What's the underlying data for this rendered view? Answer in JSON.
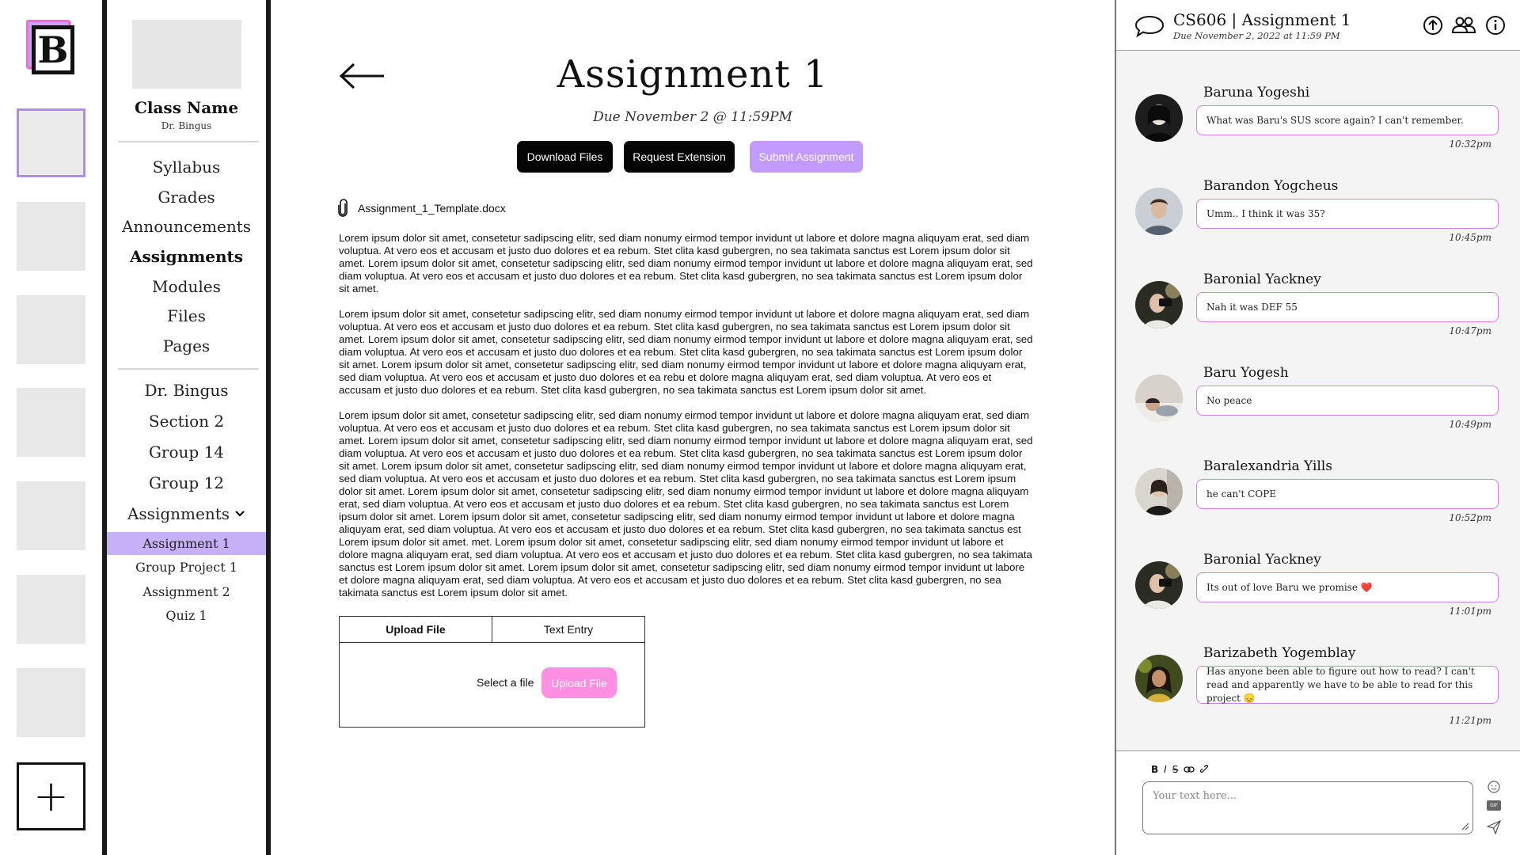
{
  "rail": {
    "logo_letter": "B",
    "add_symbol": "+"
  },
  "course": {
    "name": "Class Name",
    "professor": "Dr. Bingus",
    "menu": [
      "Syllabus",
      "Grades",
      "Announcements",
      "Assignments",
      "Modules",
      "Files",
      "Pages"
    ],
    "active_menu": "Assignments",
    "groups": [
      "Dr. Bingus",
      "Section 2",
      "Group 14",
      "Group 12"
    ],
    "assignments_toggle": "Assignments",
    "assignments": [
      "Assignment 1",
      "Group Project 1",
      "Assignment 2",
      "Quiz 1"
    ],
    "active_assignment": "Assignment 1"
  },
  "main": {
    "title": "Assignment 1",
    "due": "Due November 2 @ 11:59PM",
    "buttons": {
      "download": "Download Files",
      "extension": "Request Extension",
      "submit": "Submit Assignment"
    },
    "attachment": "Assignment_1_Template.docx",
    "paragraphs": [
      "Lorem ipsum dolor sit amet, consetetur sadipscing elitr, sed diam nonumy eirmod tempor invidunt ut labore et dolore magna aliquyam erat, sed diam voluptua. At vero eos et accusam et justo duo dolores et ea rebum. Stet clita kasd gubergren, no sea takimata sanctus est Lorem ipsum dolor sit amet. Lorem ipsum dolor sit amet, consetetur sadipscing elitr, sed diam nonumy eirmod tempor invidunt ut labore et dolore magna aliquyam erat, sed diam voluptua. At vero eos et accusam et justo duo dolores et ea rebum. Stet clita kasd gubergren, no sea takimata sanctus est Lorem ipsum dolor sit amet.",
      "Lorem ipsum dolor sit amet, consetetur sadipscing elitr, sed diam nonumy eirmod tempor invidunt ut labore et dolore magna aliquyam erat, sed diam voluptua. At vero eos et accusam et justo duo dolores et ea rebum. Stet clita kasd gubergren, no sea takimata sanctus est Lorem ipsum dolor sit amet. Lorem ipsum dolor sit amet, consetetur sadipscing elitr, sed diam nonumy eirmod tempor invidunt ut labore et dolore magna aliquyam erat, sed diam voluptua. At vero eos et accusam et justo duo dolores et ea rebum. Stet clita kasd gubergren, no sea takimata sanctus est Lorem ipsum dolor sit amet. Lorem ipsum dolor sit amet, consetetur sadipscing elitr, sed diam nonumy eirmod tempor invidunt ut labore et dolore magna aliquyam erat, sed diam voluptua. At vero eos et accusam et justo duo dolores et ea rebu et dolore magna aliquyam erat, sed diam voluptua. At vero eos et accusam et justo duo dolores et ea rebum. Stet clita kasd gubergren, no sea takimata sanctus est Lorem ipsum dolor sit amet.",
      "Lorem ipsum dolor sit amet, consetetur sadipscing elitr, sed diam nonumy eirmod tempor invidunt ut labore et dolore magna aliquyam erat, sed diam voluptua. At vero eos et accusam et justo duo dolores et ea rebum. Stet clita kasd gubergren, no sea takimata sanctus est Lorem ipsum dolor sit amet. Lorem ipsum dolor sit amet, consetetur sadipscing elitr, sed diam nonumy eirmod tempor invidunt ut labore et dolore magna aliquyam erat, sed diam voluptua. At vero eos et accusam et justo duo dolores et ea rebum. Stet clita kasd gubergren, no sea takimata sanctus est Lorem ipsum dolor sit amet. Lorem ipsum dolor sit amet, consetetur sadipscing elitr, sed diam nonumy eirmod tempor invidunt ut labore et dolore magna aliquyam erat, sed diam voluptua. At vero eos et accusam et justo duo dolores et ea rebum. Stet clita kasd gubergren, no sea takimata sanctus est Lorem ipsum dolor sit amet. Lorem ipsum dolor sit amet, consetetur sadipscing elitr, sed diam nonumy eirmod tempor invidunt ut labore et dolore magna aliquyam erat, sed diam voluptua. At vero eos et accusam et justo duo dolores et ea rebum. Stet clita kasd gubergren, no sea takimata sanctus est Lorem ipsum dolor sit amet. Lorem ipsum dolor sit amet, consetetur sadipscing elitr, sed diam nonumy eirmod tempor invidunt ut labore et dolore magna aliquyam erat, sed diam voluptua. At vero eos et accusam et justo duo dolores et ea rebum. Stet clita kasd gubergren, no sea takimata sanctus est Lorem ipsum dolor sit amet. met. Lorem ipsum dolor sit amet, consetetur sadipscing elitr, sed diam nonumy eirmod tempor invidunt ut labore et dolore magna aliquyam erat, sed diam voluptua. At vero eos et accusam et justo duo dolores et ea rebum. Stet clita kasd gubergren, no sea takimata sanctus est Lorem ipsum dolor sit amet. Lorem ipsum dolor sit amet, consetetur sadipscing elitr, sed diam nonumy eirmod tempor invidunt ut labore et dolore magna aliquyam erat, sed diam voluptua. At vero eos et accusam et justo duo dolores et ea rebum. Stet clita kasd gubergren, no sea takimata sanctus est Lorem ipsum dolor sit amet."
    ],
    "upload": {
      "tab_upload": "Upload File",
      "tab_text": "Text Entry",
      "select_label": "Select a file",
      "upload_button": "Upload File"
    }
  },
  "chat": {
    "title": "CS606 | Assignment 1",
    "due": "Due November 2, 2022 at 11:59 PM",
    "header_icons": [
      "upload-icon",
      "people-icon",
      "info-icon"
    ],
    "messages": [
      {
        "name": "Baruna Yogeshi",
        "text": "What was Baru's SUS score again? I can't remember.",
        "time": "10:32pm"
      },
      {
        "name": "Barandon Yogcheus",
        "text": "Umm.. I think it was 35?",
        "time": "10:45pm"
      },
      {
        "name": "Baronial Yackney",
        "text": "Nah it was DEF 55",
        "time": "10:47pm"
      },
      {
        "name": "Baru Yogesh",
        "text": "No peace",
        "time": "10:49pm"
      },
      {
        "name": "Baralexandria Yills",
        "text": "he can't COPE",
        "time": "10:52pm"
      },
      {
        "name": "Baronial Yackney",
        "text": "Its out of love Baru we promise ❤️",
        "time": "11:01pm"
      },
      {
        "name": "Barizabeth Yogemblay",
        "text": "Has anyone been able to figure out how to read? I can't read and apparently we have to be able to read for this project 😞",
        "time": "11:21pm"
      }
    ],
    "composer": {
      "placeholder": "Your text here...",
      "format_buttons": [
        "B",
        "I",
        "S"
      ],
      "gif_label": "GIF"
    }
  }
}
